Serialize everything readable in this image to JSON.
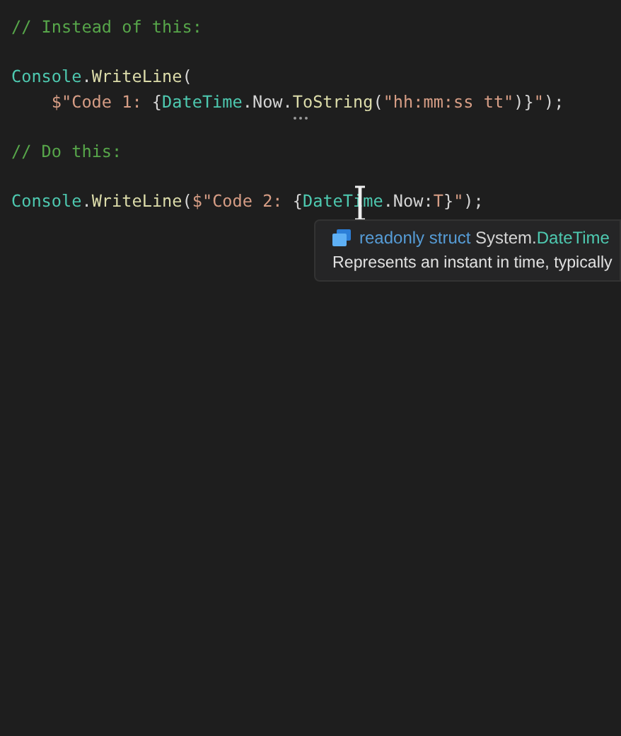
{
  "editor": {
    "lines": [
      {
        "tokens": [
          {
            "kind": "comment",
            "text": "// Instead of this:"
          }
        ]
      },
      {
        "blank_line_before": true,
        "tokens": [
          {
            "kind": "type",
            "text": "Console"
          },
          {
            "kind": "plain",
            "text": "."
          },
          {
            "kind": "method",
            "text": "WriteLine"
          },
          {
            "kind": "plain",
            "text": "("
          }
        ]
      },
      {
        "indent": true,
        "tokens": [
          {
            "kind": "string",
            "text": "$\"Code 1: "
          },
          {
            "kind": "plain",
            "text": "{"
          },
          {
            "kind": "type",
            "text": "DateTime"
          },
          {
            "kind": "plain",
            "text": ".Now."
          },
          {
            "kind": "method",
            "text": "ToString",
            "hint": true
          },
          {
            "kind": "plain",
            "text": "("
          },
          {
            "kind": "string",
            "text": "\"hh:mm:ss tt\""
          },
          {
            "kind": "plain",
            "text": ")}"
          },
          {
            "kind": "string",
            "text": "\""
          },
          {
            "kind": "plain",
            "text": ");"
          }
        ]
      },
      {
        "blank_line_before": true,
        "tokens": [
          {
            "kind": "comment",
            "text": "// Do this:"
          }
        ]
      },
      {
        "blank_line_before": true,
        "tokens": [
          {
            "kind": "type",
            "text": "Console"
          },
          {
            "kind": "plain",
            "text": "."
          },
          {
            "kind": "method",
            "text": "WriteLine"
          },
          {
            "kind": "plain",
            "text": "("
          },
          {
            "kind": "string",
            "text": "$\"Code 2: "
          },
          {
            "kind": "plain",
            "text": "{"
          },
          {
            "kind": "type",
            "text": "DateTime",
            "cursor": true
          },
          {
            "kind": "plain",
            "text": ".Now:"
          },
          {
            "kind": "string",
            "text": "T"
          },
          {
            "kind": "plain",
            "text": "}"
          },
          {
            "kind": "string",
            "text": "\""
          },
          {
            "kind": "plain",
            "text": ");"
          }
        ]
      }
    ]
  },
  "tooltip": {
    "signature": [
      {
        "kind": "keyword",
        "text": "readonly struct"
      },
      {
        "kind": "plain",
        "text": "System."
      },
      {
        "kind": "type",
        "text": "DateTime"
      }
    ],
    "description": "Represents an instant in time, typically"
  }
}
